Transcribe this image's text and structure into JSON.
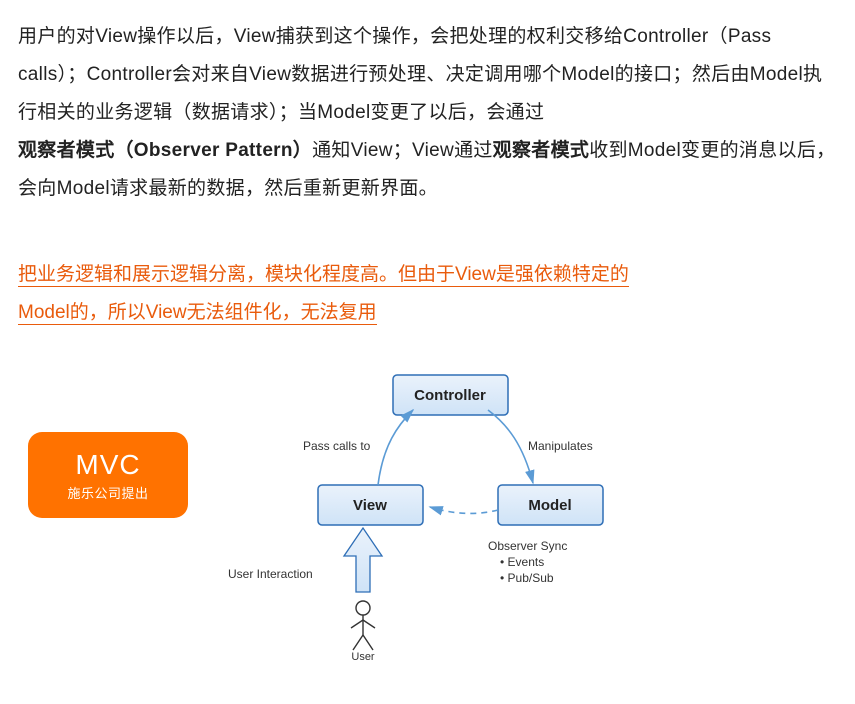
{
  "para": {
    "t1": "用户的对View操作以后，View捕获到这个操作，会把处理的权利交移给Controller（Pass calls）；Controller会对来自View数据进行预处理、决定调用哪个Model的接口；然后由Model执行相关的业务逻辑（数据请求）；当Model变更了以后，会通过",
    "b1": "观察者模式（Observer Pattern）",
    "t2": "通知View；View通过",
    "b2": "观察者模式",
    "t3": "收到Model变更的消息以后，会向Model请求最新的数据，然后重新更新界面。"
  },
  "highlight": {
    "line1": "把业务逻辑和展示逻辑分离，模块化程度高。但由于View是强依赖特定的",
    "line2": "Model的，所以View无法组件化，无法复用"
  },
  "badge": {
    "title": "MVC",
    "sub": "施乐公司提出"
  },
  "diagram": {
    "nodes": {
      "controller": "Controller",
      "view": "View",
      "model": "Model"
    },
    "labels": {
      "passCalls": "Pass calls to",
      "manipulates": "Manipulates",
      "userInteraction": "User Interaction",
      "observerSync": "Observer Sync",
      "events": "Events",
      "pubsub": "Pub/Sub",
      "user": "User"
    }
  }
}
